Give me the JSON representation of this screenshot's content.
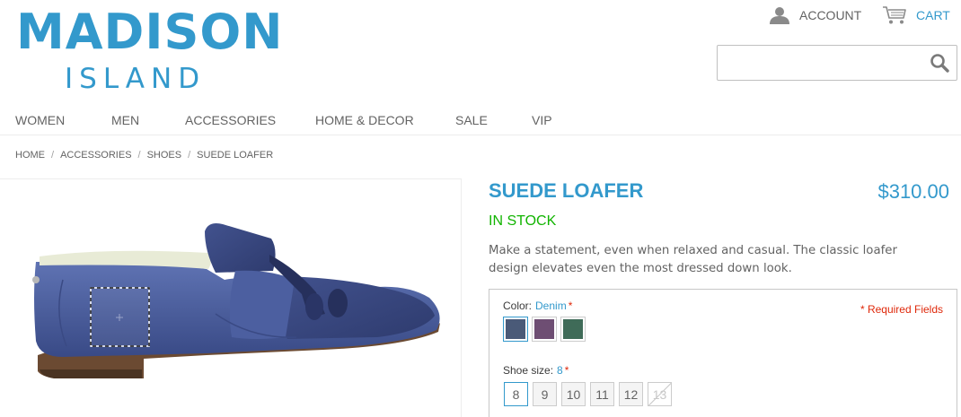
{
  "logo": {
    "main": "MADISON",
    "sub": "ISLAND"
  },
  "header": {
    "account_label": "ACCOUNT",
    "account_icon": "user-icon",
    "cart_label": "CART",
    "cart_icon": "cart-icon",
    "search_placeholder": "",
    "search_icon": "search-icon"
  },
  "nav": {
    "items": [
      {
        "label": "WOMEN"
      },
      {
        "label": "MEN"
      },
      {
        "label": "ACCESSORIES"
      },
      {
        "label": "HOME & DECOR"
      },
      {
        "label": "SALE"
      },
      {
        "label": "VIP"
      }
    ]
  },
  "breadcrumb": {
    "items": [
      {
        "label": "HOME"
      },
      {
        "label": "ACCESSORIES"
      },
      {
        "label": "SHOES"
      },
      {
        "label": "SUEDE LOAFER"
      }
    ],
    "separator": "/"
  },
  "product": {
    "name": "SUEDE LOAFER",
    "price": "$310.00",
    "stock": "IN STOCK",
    "description": "Make a statement, even when relaxed and casual. The classic loafer design elevates even the most dressed down look."
  },
  "options": {
    "required_note": "* Required Fields",
    "color": {
      "label": "Color:",
      "selected": "Denim",
      "star": "*",
      "swatches": [
        {
          "name": "Denim",
          "color": "#4a5a78",
          "selected": true
        },
        {
          "name": "Purple",
          "color": "#6e4e73",
          "selected": false
        },
        {
          "name": "Green",
          "color": "#3f6b58",
          "selected": false
        }
      ]
    },
    "size": {
      "label": "Shoe size:",
      "selected": "8",
      "star": "*",
      "sizes": [
        {
          "label": "8",
          "state": "selected"
        },
        {
          "label": "9",
          "state": "normal"
        },
        {
          "label": "10",
          "state": "normal"
        },
        {
          "label": "11",
          "state": "normal"
        },
        {
          "label": "12",
          "state": "normal"
        },
        {
          "label": "13",
          "state": "disabled"
        }
      ]
    }
  },
  "colors": {
    "brand_blue": "#3399cc",
    "in_stock_green": "#11b400",
    "required_red": "#df280a"
  }
}
